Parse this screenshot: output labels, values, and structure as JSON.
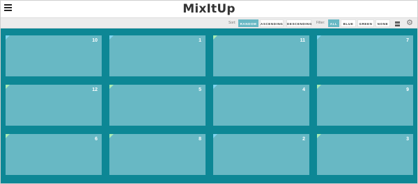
{
  "header": {
    "title": "MixItUp",
    "menu_icon": "hamburger-menu-icon"
  },
  "controls": {
    "sort_label": "Sort:",
    "sort_options": [
      "RANDOM",
      "ASCENDING",
      "DESCENDING"
    ],
    "sort_active": "RANDOM",
    "filter_label": "Filter:",
    "filter_options": [
      "ALL",
      "BLUE",
      "GREEN",
      "NONE"
    ],
    "filter_active": "ALL",
    "view_icon": "list-view-icon",
    "settings_icon": "gear-icon"
  },
  "colors": {
    "stage": "#0d8795",
    "tile": "#68b8c4",
    "active": "#68b8c4",
    "flag_blue": "#7ed4ef",
    "flag_green": "#a8ecb4"
  },
  "tiles": [
    {
      "number": "10",
      "flag": "blue"
    },
    {
      "number": "1",
      "flag": "blue"
    },
    {
      "number": "11",
      "flag": "green"
    },
    {
      "number": "7",
      "flag": "blue"
    },
    {
      "number": "12",
      "flag": "green"
    },
    {
      "number": "5",
      "flag": "green"
    },
    {
      "number": "4",
      "flag": "blue"
    },
    {
      "number": "9",
      "flag": "green"
    },
    {
      "number": "6",
      "flag": "green"
    },
    {
      "number": "8",
      "flag": "green"
    },
    {
      "number": "2",
      "flag": "blue"
    },
    {
      "number": "3",
      "flag": "green"
    }
  ]
}
